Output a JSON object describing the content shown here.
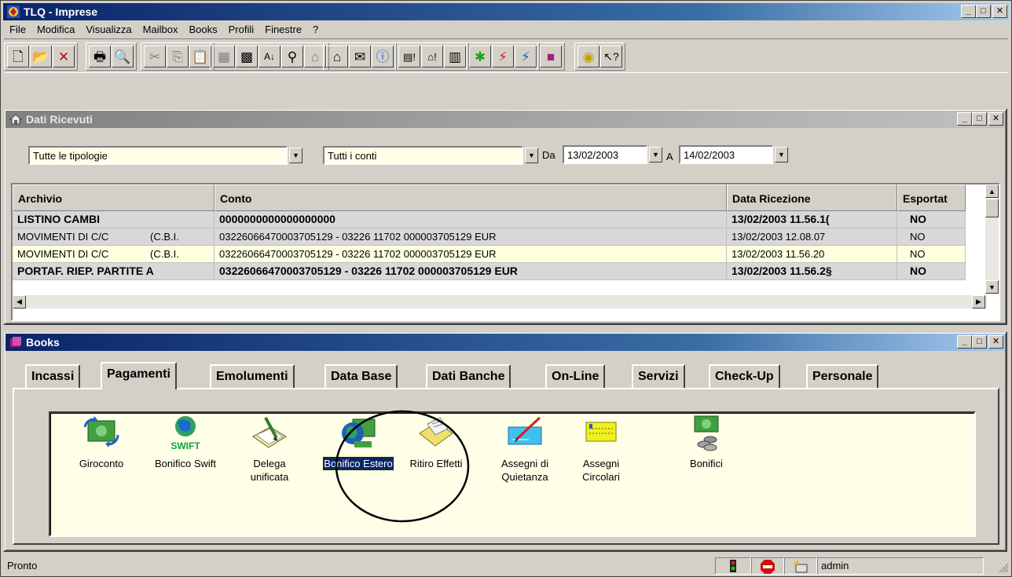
{
  "app": {
    "title": "TLQ - Imprese"
  },
  "menu": [
    "File",
    "Modifica",
    "Visualizza",
    "Mailbox",
    "Books",
    "Profili",
    "Finestre",
    "?"
  ],
  "dati_ricevuti": {
    "title": "Dati Ricevuti",
    "filters": {
      "tipologia": "Tutte le tipologie",
      "conto": "Tutti i conti",
      "da_label": "Da",
      "da_value": "13/02/2003",
      "a_label": "A",
      "a_value": "14/02/2003"
    },
    "columns": [
      "Archivio",
      "Conto",
      "Data Ricezione",
      "Esportat"
    ],
    "rows": [
      {
        "archivio": "LISTINO CAMBI",
        "cbi": "",
        "conto": "0000000000000000000",
        "data": "13/02/2003 11.56.1(",
        "esportato": "NO",
        "bold": true,
        "bg": "#d8d8d8"
      },
      {
        "archivio": "MOVIMENTI DI C/C",
        "cbi": "(C.B.I.",
        "conto": "03226066470003705129 - 03226 11702 000003705129 EUR",
        "data": "13/02/2003 12.08.07",
        "esportato": "NO",
        "bold": false,
        "bg": "#d8d8d8"
      },
      {
        "archivio": "MOVIMENTI DI C/C",
        "cbi": "(C.B.I.",
        "conto": "03226066470003705129 - 03226 11702 000003705129 EUR",
        "data": "13/02/2003 11.56.20",
        "esportato": "NO",
        "bold": false,
        "bg": "#ffffe0"
      },
      {
        "archivio": "PORTAF. RIEP. PARTITE A",
        "cbi": "",
        "conto": "03226066470003705129 - 03226 11702 000003705129 EUR",
        "data": "13/02/2003 11.56.2§",
        "esportato": "NO",
        "bold": true,
        "bg": "#d8d8d8"
      }
    ]
  },
  "books": {
    "title": "Books",
    "tabs": [
      "Incassi",
      "Pagamenti",
      "Emolumenti",
      "Data Base",
      "Dati Banche",
      "On-Line",
      "Servizi",
      "Check-Up",
      "Personale"
    ],
    "active_tab": "Pagamenti",
    "items": [
      {
        "label": "Giroconto",
        "line2": "",
        "icon": "giroconto-icon"
      },
      {
        "label": "Bonifico Swift",
        "line2": "",
        "icon": "swift-icon",
        "icon_text": "SWIFT"
      },
      {
        "label": "Delega",
        "line2": "unificata",
        "icon": "delega-icon"
      },
      {
        "label": "Bonifico Estero",
        "line2": "",
        "icon": "globe-icon",
        "selected": true
      },
      {
        "label": "Ritiro Effetti",
        "line2": "",
        "icon": "envelope-icon"
      },
      {
        "label": "Assegni di",
        "line2": "Quietanza",
        "icon": "cheque-icon"
      },
      {
        "label": "Assegni",
        "line2": "Circolari",
        "icon": "circolari-icon"
      },
      {
        "label": "Bonifici",
        "line2": "",
        "icon": "bonifici-icon"
      }
    ]
  },
  "status": {
    "text": "Pronto",
    "user": "admin"
  }
}
